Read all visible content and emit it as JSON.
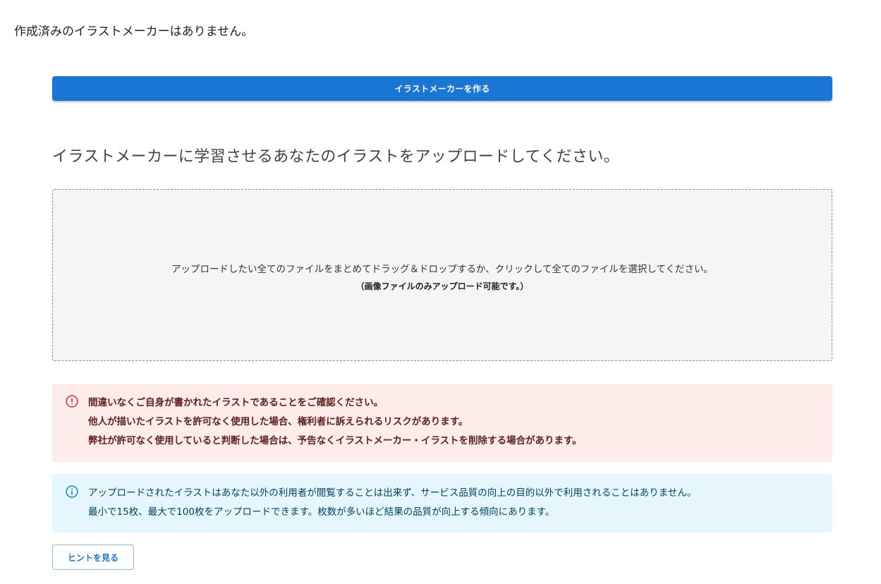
{
  "status": {
    "no_makers_text": "作成済みのイラストメーカーはありません。"
  },
  "actions": {
    "create_button_label": "イラストメーカーを作る",
    "hint_button_label": "ヒントを見る"
  },
  "upload": {
    "heading": "イラストメーカーに学習させるあなたのイラストをアップロードしてください。",
    "dropzone_text": "アップロードしたい全てのファイルをまとめてドラッグ＆ドロップするか、クリックして全てのファイルを選択してください。",
    "dropzone_subtext": "（画像ファイルのみアップロード可能です。）"
  },
  "alerts": {
    "error": {
      "icon": "error-outline-icon",
      "color": "#d32f2f",
      "background": "#fdecea",
      "lines": [
        "間違いなくご自身が書かれたイラストであることをご確認ください。",
        "他人が描いたイラストを許可なく使用した場合、権利者に訴えられるリスクがあります。",
        "弊社が許可なく使用していると判断した場合は、予告なくイラストメーカー・イラストを削除する場合があります。"
      ]
    },
    "info": {
      "icon": "info-outline-icon",
      "color": "#0288d1",
      "background": "#e5f6fd",
      "lines": [
        "アップロードされたイラストはあなた以外の利用者が閲覧することは出来ず、サービス品質の向上の目的以外で利用されることはありません。",
        "最小で15枚、最大で100枚をアップロードできます。枚数が多いほど結果の品質が向上する傾向にあります。"
      ]
    }
  },
  "colors": {
    "primary": "#1976d2"
  }
}
